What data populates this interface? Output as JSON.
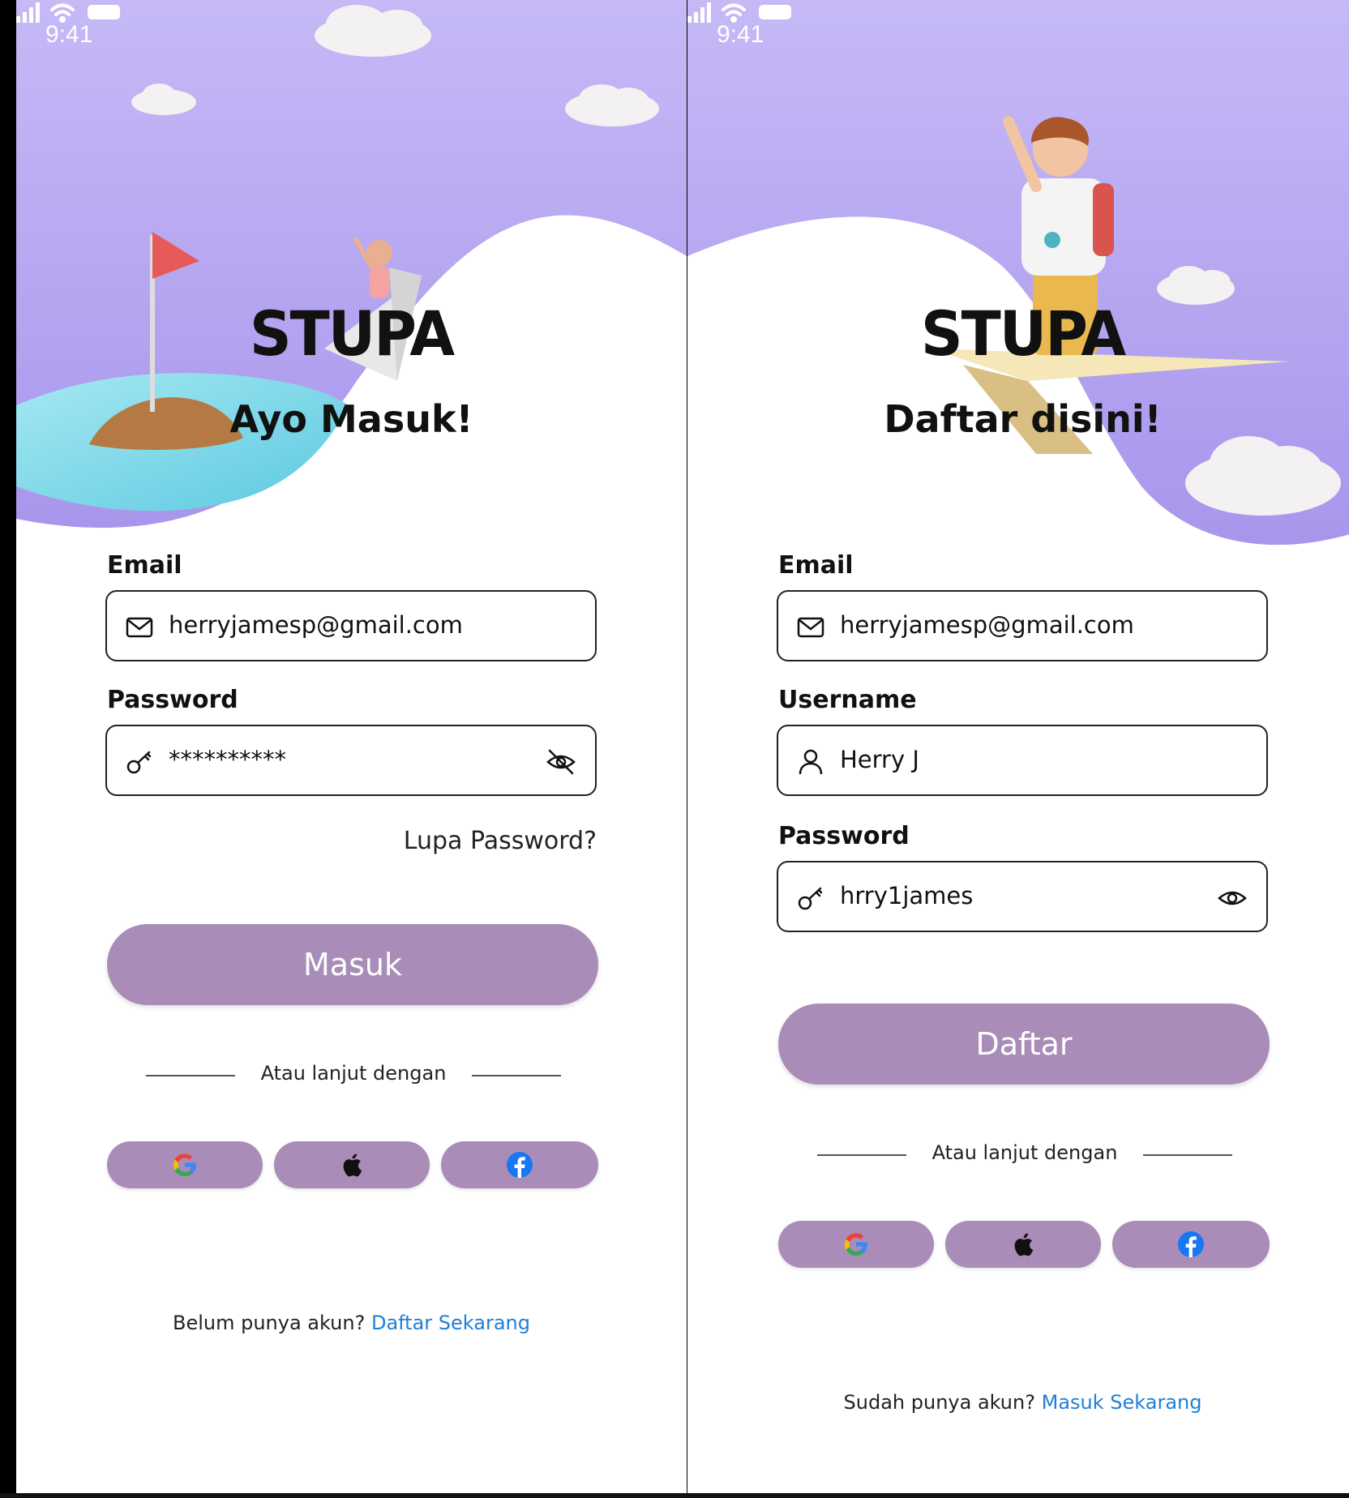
{
  "colors": {
    "sky_top": "#C6B9F6",
    "sky_bottom": "#A896EC",
    "button": "#A98DB8",
    "link": "#1E7FD9",
    "text": "#111111"
  },
  "login": {
    "status_time": "9:41",
    "brand": "STUPA",
    "heading": "Ayo Masuk!",
    "email": {
      "label": "Email",
      "value": "herryjamesp@gmail.com",
      "icon": "mail-icon"
    },
    "password": {
      "label": "Password",
      "value": "**********",
      "icon": "key-icon",
      "toggle_icon": "eye-off-icon"
    },
    "forgot_label": "Lupa Password?",
    "submit_label": "Masuk",
    "divider_text": "Atau lanjut dengan",
    "social": [
      "google-icon",
      "apple-icon",
      "facebook-icon"
    ],
    "footer_text": "Belum punya akun?",
    "footer_link": "Daftar Sekarang"
  },
  "register": {
    "status_time": "9:41",
    "brand": "STUPA",
    "heading": "Daftar disini!",
    "email": {
      "label": "Email",
      "value": "herryjamesp@gmail.com",
      "icon": "mail-icon"
    },
    "username": {
      "label": "Username",
      "value": "Herry J",
      "icon": "user-icon"
    },
    "password": {
      "label": "Password",
      "value": "hrry1james",
      "icon": "key-icon",
      "toggle_icon": "eye-icon"
    },
    "submit_label": "Daftar",
    "divider_text": "Atau lanjut dengan",
    "social": [
      "google-icon",
      "apple-icon",
      "facebook-icon"
    ],
    "footer_text": "Sudah punya akun?",
    "footer_link": "Masuk Sekarang"
  }
}
